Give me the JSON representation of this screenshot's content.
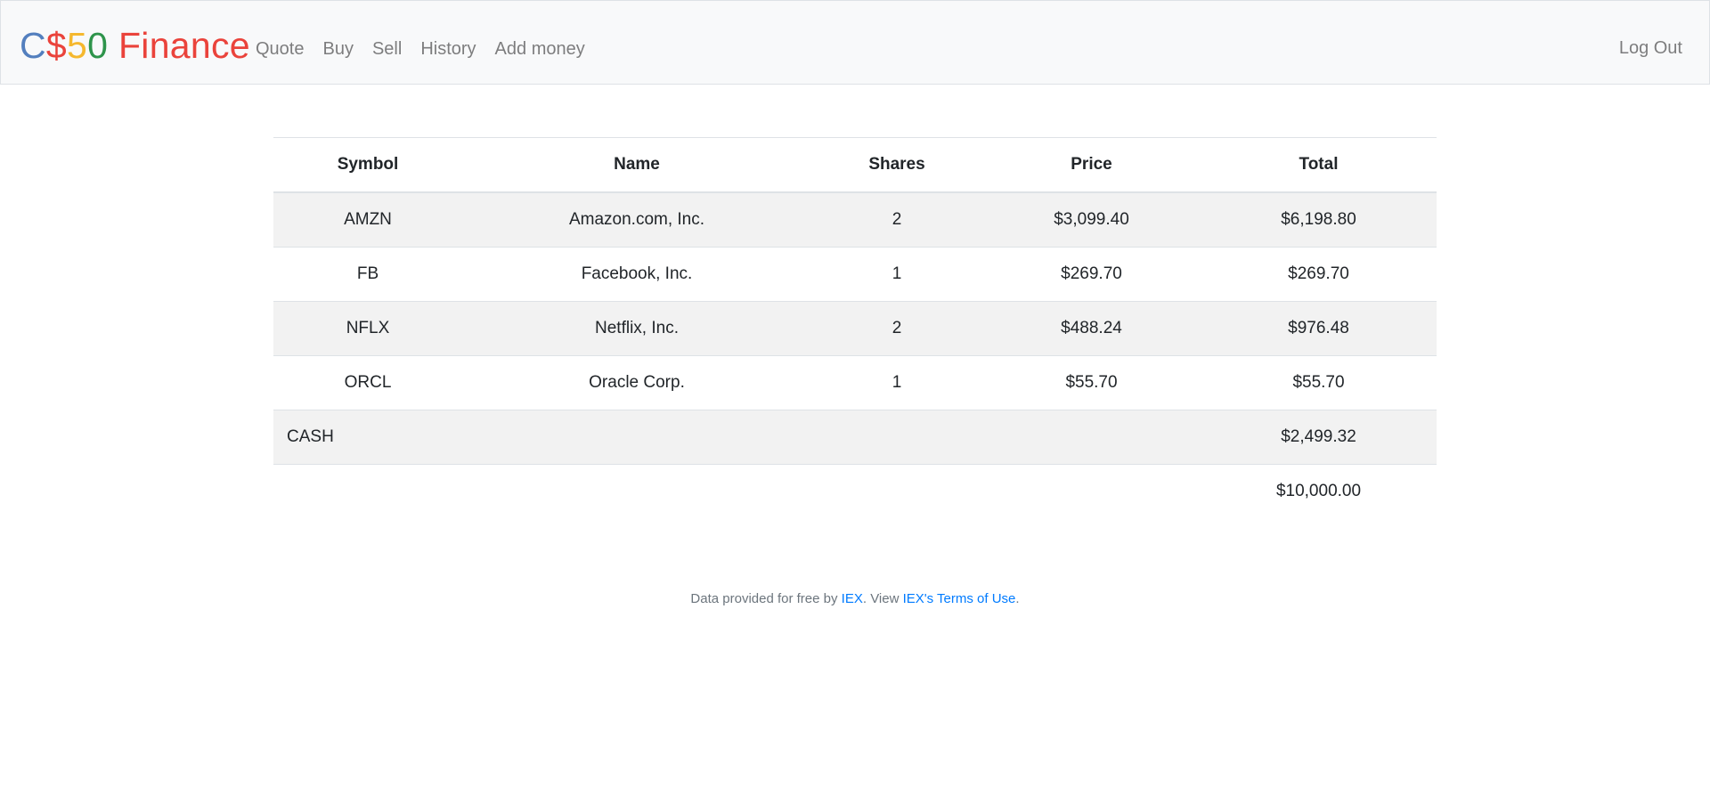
{
  "navbar": {
    "brand": {
      "parts": [
        "C",
        "$",
        "5",
        "0",
        " Finance"
      ],
      "colors": [
        "#537fbe",
        "#ea433b",
        "#f5b82e",
        "#2e944b",
        "#ea433b"
      ]
    },
    "links": [
      "Quote",
      "Buy",
      "Sell",
      "History",
      "Add money"
    ],
    "logout": "Log Out"
  },
  "portfolio": {
    "headers": [
      "Symbol",
      "Name",
      "Shares",
      "Price",
      "Total"
    ],
    "rows": [
      {
        "symbol": "AMZN",
        "name": "Amazon.com, Inc.",
        "shares": "2",
        "price": "$3,099.40",
        "total": "$6,198.80"
      },
      {
        "symbol": "FB",
        "name": "Facebook, Inc.",
        "shares": "1",
        "price": "$269.70",
        "total": "$269.70"
      },
      {
        "symbol": "NFLX",
        "name": "Netflix, Inc.",
        "shares": "2",
        "price": "$488.24",
        "total": "$976.48"
      },
      {
        "symbol": "ORCL",
        "name": "Oracle Corp.",
        "shares": "1",
        "price": "$55.70",
        "total": "$55.70"
      }
    ],
    "cash_label": "CASH",
    "cash_value": "$2,499.32",
    "grand_total": "$10,000.00"
  },
  "footer": {
    "prefix": "Data provided for free by ",
    "iex_link": "IEX",
    "middle": ". View ",
    "terms_link": "IEX's Terms of Use",
    "suffix": "."
  }
}
